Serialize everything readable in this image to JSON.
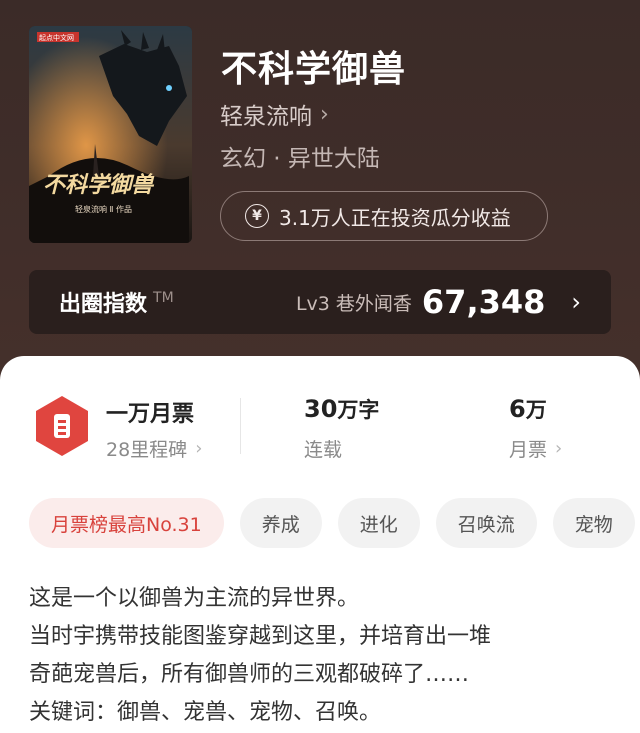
{
  "book": {
    "title": "不科学御兽",
    "author": "轻泉流响",
    "genre": "玄幻 · 异世大陆",
    "cover": {
      "publisher_badge": "起点中文网",
      "title": "不科学御兽",
      "byline": "轻泉流响 Ⅱ 作品"
    }
  },
  "invest": {
    "icon": "yen-icon",
    "text": "3.1万人正在投资瓜分收益"
  },
  "index": {
    "label": "出圈指数",
    "tm": "TM",
    "level": "Lv3 巷外闻香",
    "value": "67,348"
  },
  "stats": {
    "monthly": {
      "title": "一万月票",
      "sub": "28里程碑"
    },
    "words": {
      "value": "30",
      "unit": "万字",
      "sub": "连载"
    },
    "votes": {
      "value": "6",
      "unit": "万",
      "sub": "月票"
    }
  },
  "tags": [
    "月票榜最高No.31",
    "养成",
    "进化",
    "召唤流",
    "宠物"
  ],
  "description": [
    "这是一个以御兽为主流的异世界。",
    "当时宇携带技能图鉴穿越到这里，并培育出一堆",
    "奇葩宠兽后，所有御兽师的三观都破碎了……",
    "关键词：御兽、宠兽、宠物、召唤。"
  ],
  "colors": {
    "accent": "#e0453f",
    "hero_bg": "#3b2b28"
  }
}
